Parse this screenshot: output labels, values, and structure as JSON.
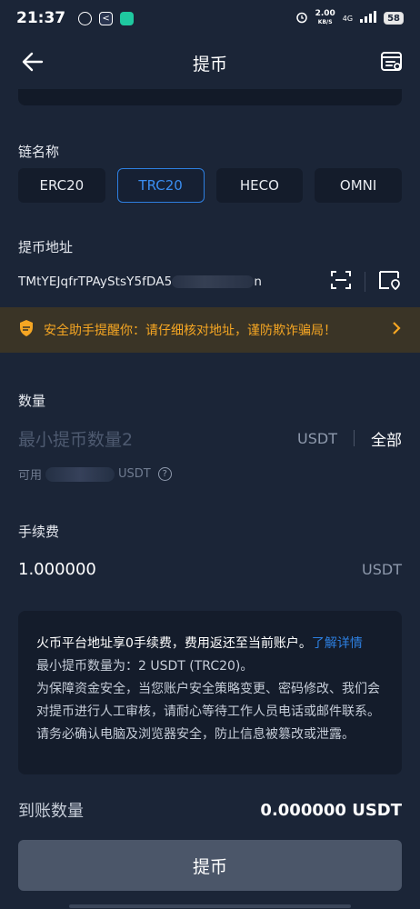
{
  "statusbar": {
    "time": "21:37",
    "net_speed_value": "2.00",
    "net_speed_unit": "KB/S",
    "signal": "4G",
    "battery": "58"
  },
  "header": {
    "title": "提币"
  },
  "chain": {
    "label": "链名称",
    "options": [
      "ERC20",
      "TRC20",
      "HECO",
      "OMNI"
    ],
    "selected": "TRC20"
  },
  "address": {
    "label": "提币地址",
    "value": "TMtYEJqfrTPAyStsY5fDA5",
    "tail": "n"
  },
  "warning": {
    "text": "安全助手提醒你：请仔细核对地址，谨防欺诈骗局！"
  },
  "amount": {
    "label": "数量",
    "placeholder": "最小提币数量2",
    "unit": "USDT",
    "all_label": "全部",
    "available_prefix": "可用",
    "available_unit": "USDT"
  },
  "fee": {
    "label": "手续费",
    "value": "1.000000",
    "unit": "USDT"
  },
  "notice": {
    "line1": "火币平台地址享0手续费，费用返还至当前账户。",
    "link": "了解详情",
    "line2": "最小提币数量为：2 USDT (TRC20)。",
    "line3": "为保障资金安全，当您账户安全策略变更、密码修改、我们会对提币进行人工审核，请耐心等待工作人员电话或邮件联系。",
    "line4": "请务必确认电脑及浏览器安全，防止信息被篡改或泄露。"
  },
  "footer": {
    "receive_label": "到账数量",
    "receive_value": "0.000000 USDT",
    "submit_label": "提币"
  },
  "colors": {
    "background": "#1b2537",
    "accent": "#2d7fe0",
    "warning": "#f5a623",
    "button": "#4b5669"
  }
}
